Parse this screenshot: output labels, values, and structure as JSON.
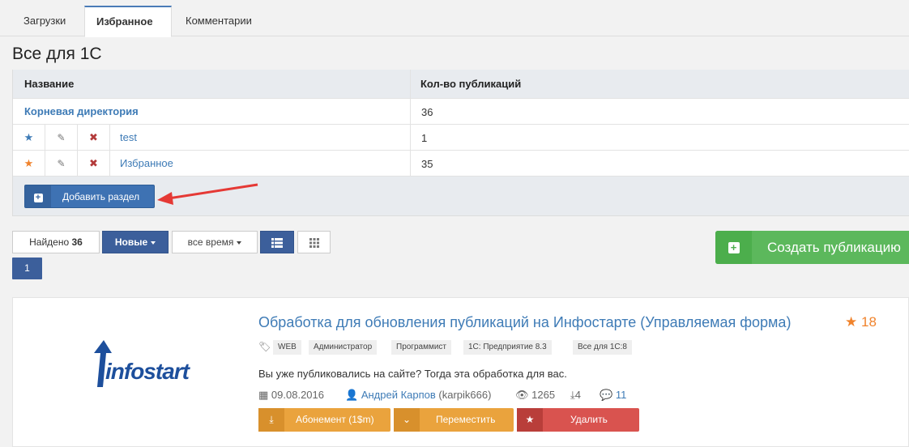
{
  "tabs": [
    {
      "label": "Загрузки"
    },
    {
      "label": "Избранное"
    },
    {
      "label": "Комментарии"
    }
  ],
  "page_title": "Все для 1С",
  "sections": {
    "columns": [
      "Название",
      "Кол-во публикаций"
    ],
    "root": {
      "name": "Корневая директория",
      "count": "36"
    },
    "rows": [
      {
        "name": "test",
        "count": "1",
        "star_color": "#3e7bb6"
      },
      {
        "name": "Избранное",
        "count": "35",
        "star_color": "#f0832c"
      }
    ],
    "add_label": "Добавить раздел"
  },
  "toolbar": {
    "found_label": "Найдено",
    "found_count": "36",
    "sort_label": "Новые",
    "period_label": "все время",
    "page": "1",
    "create_label": "Создать публикацию"
  },
  "publication": {
    "logo_text": "infostart",
    "title": "Обработка для обновления публикаций на Инфостарте (Управляемая форма)",
    "rating": "18",
    "tags": [
      "WEB",
      "Администратор",
      "Программист",
      "1С: Предприятие 8.3",
      "Все для 1С:8"
    ],
    "description": "Вы уже публиковались на сайте? Тогда эта обработка для вас.",
    "date": "09.08.2016",
    "author": "Андрей Карпов",
    "author_login": "(karpik666)",
    "views": "1265",
    "downloads": "4",
    "comments": "11",
    "subscribe_label": "Абонемент (1$m)",
    "move_label": "Переместить",
    "delete_label": "Удалить"
  },
  "colors": {
    "accent": "#3e7bb6",
    "primary_button": "#3c5f9b",
    "create_green": "#5cb85c",
    "warning_orange": "#eaa33d",
    "danger_red": "#d9534f",
    "star_orange": "#f0832c"
  }
}
